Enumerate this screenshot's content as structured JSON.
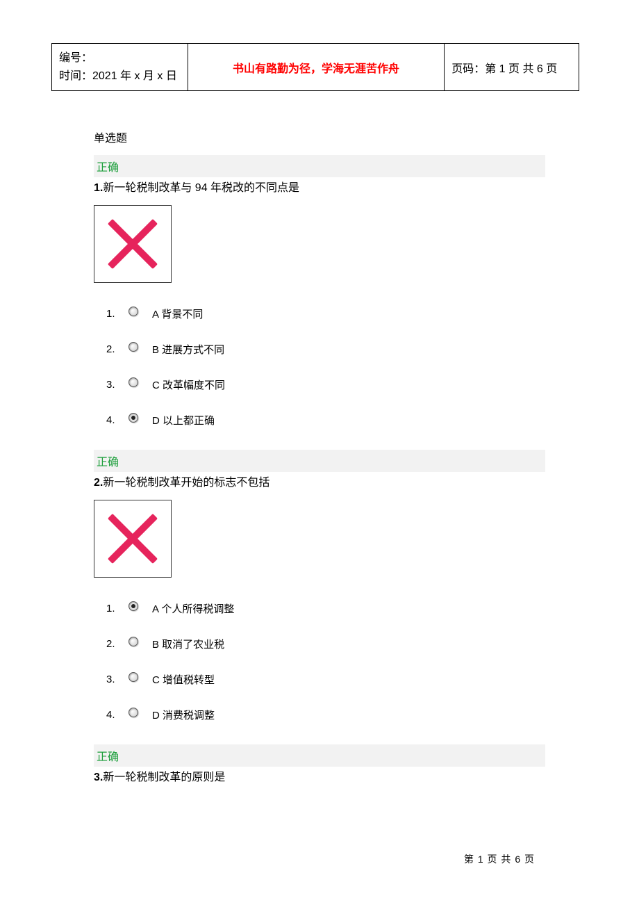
{
  "header": {
    "id_label": "编号：",
    "time_label": "时间：2021 年 x 月 x 日",
    "quote": "书山有路勤为径，学海无涯苦作舟",
    "page_info": "页码：第 1 页  共 6 页"
  },
  "section_title": "单选题",
  "questions": [
    {
      "status": "正确",
      "number": "1.",
      "text": "新一轮税制改革与 94 年税改的不同点是",
      "selected_index": 3,
      "options": [
        {
          "num": "1.",
          "label": "A 背景不同"
        },
        {
          "num": "2.",
          "label": "B 进展方式不同"
        },
        {
          "num": "3.",
          "label": "C 改革幅度不同"
        },
        {
          "num": "4.",
          "label": "D 以上都正确"
        }
      ]
    },
    {
      "status": "正确",
      "number": "2.",
      "text": "新一轮税制改革开始的标志不包括",
      "selected_index": 0,
      "options": [
        {
          "num": "1.",
          "label": "A 个人所得税调整"
        },
        {
          "num": "2.",
          "label": "B 取消了农业税"
        },
        {
          "num": "3.",
          "label": "C 增值税转型"
        },
        {
          "num": "4.",
          "label": "D 消费税调整"
        }
      ]
    },
    {
      "status": "正确",
      "number": "3.",
      "text": "新一轮税制改革的原则是"
    }
  ],
  "footer": "第  1  页  共  6  页"
}
